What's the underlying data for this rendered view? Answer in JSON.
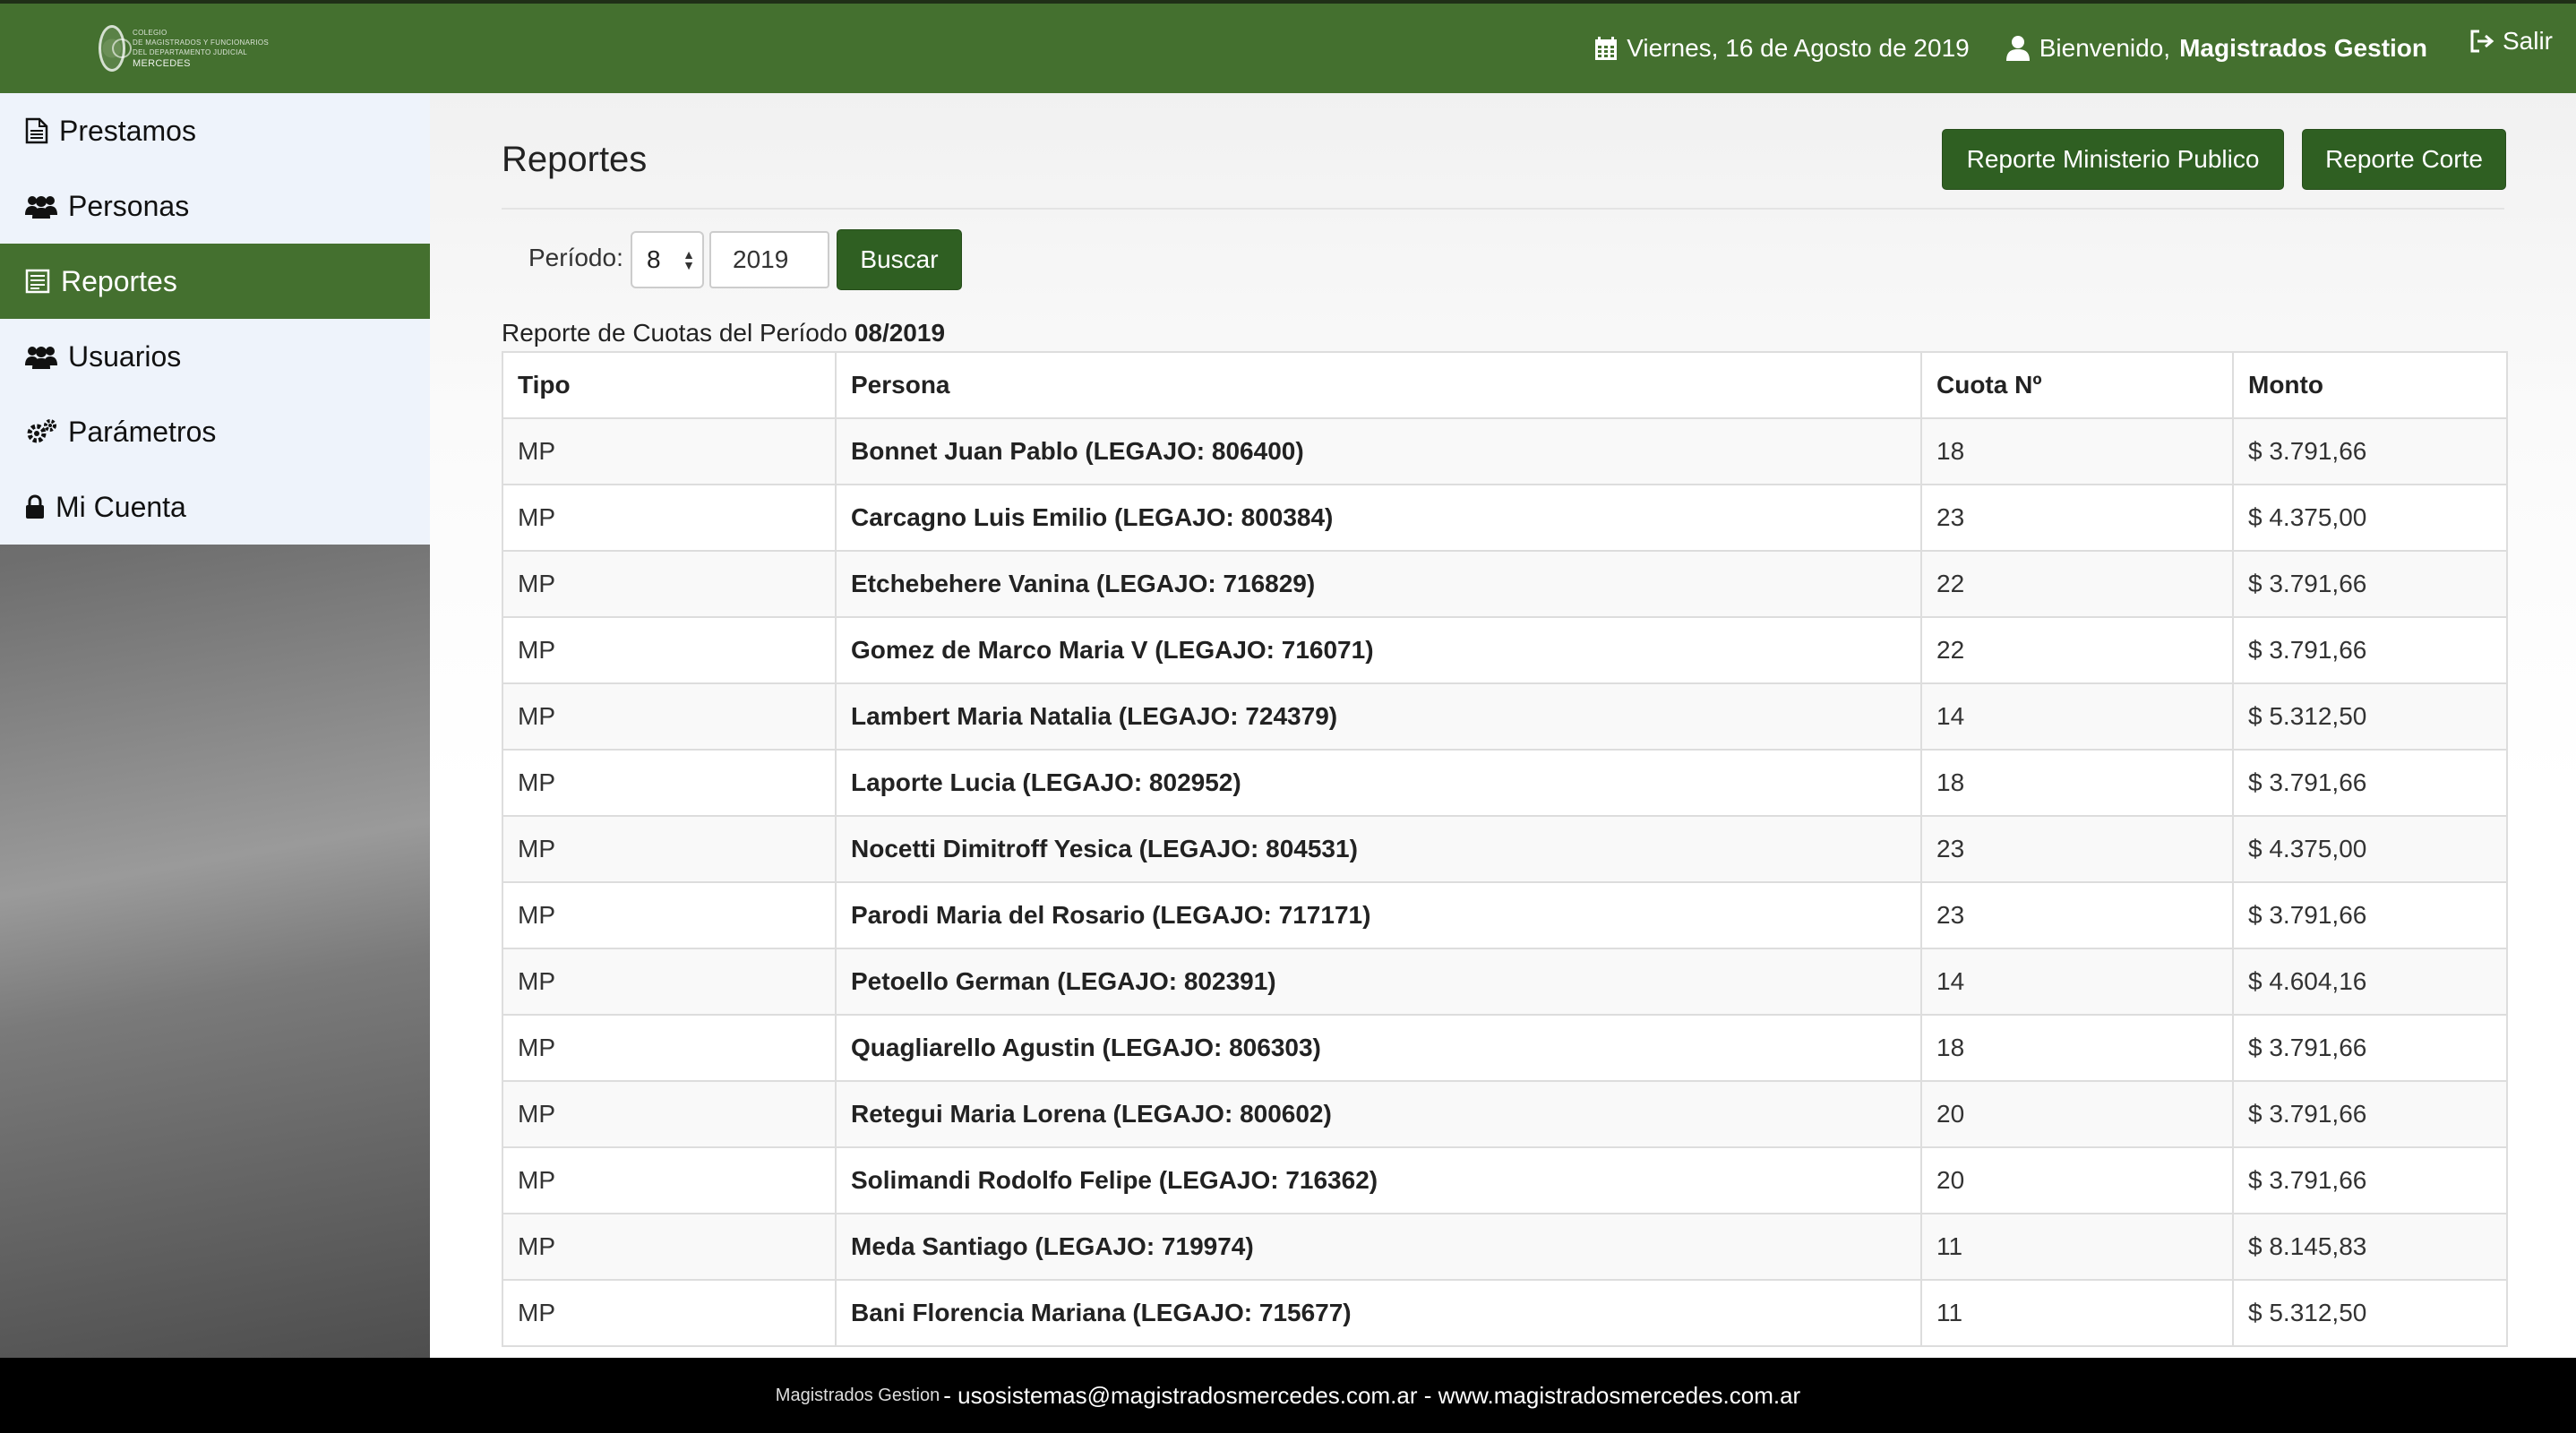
{
  "header": {
    "logo_lines": [
      "COLEGIO",
      "DE MAGISTRADOS Y FUNCIONARIOS",
      "DEL DEPARTAMENTO JUDICIAL",
      "MERCEDES"
    ],
    "date": "Viernes, 16 de Agosto de 2019",
    "welcome_prefix": "Bienvenido,",
    "user_name": "Magistrados Gestion",
    "logout_label": "Salir"
  },
  "sidebar": {
    "items": [
      {
        "label": "Prestamos",
        "icon": "document-icon"
      },
      {
        "label": "Personas",
        "icon": "users-icon"
      },
      {
        "label": "Reportes",
        "icon": "report-icon",
        "active": true
      },
      {
        "label": "Usuarios",
        "icon": "users-icon"
      },
      {
        "label": "Parámetros",
        "icon": "gears-icon"
      },
      {
        "label": "Mi Cuenta",
        "icon": "lock-icon"
      }
    ]
  },
  "main": {
    "title": "Reportes",
    "btn_ministerio": "Reporte Ministerio Publico",
    "btn_corte": "Reporte Corte",
    "filter": {
      "label": "Período:",
      "month": "8",
      "year": "2019",
      "search_label": "Buscar"
    },
    "caption_prefix": "Reporte de Cuotas del Período",
    "caption_period": "08/2019",
    "table": {
      "headers": [
        "Tipo",
        "Persona",
        "Cuota Nº",
        "Monto"
      ],
      "rows": [
        [
          "MP",
          "Bonnet Juan Pablo (LEGAJO: 806400)",
          "18",
          "$ 3.791,66"
        ],
        [
          "MP",
          "Carcagno Luis Emilio (LEGAJO: 800384)",
          "23",
          "$ 4.375,00"
        ],
        [
          "MP",
          "Etchebehere Vanina (LEGAJO: 716829)",
          "22",
          "$ 3.791,66"
        ],
        [
          "MP",
          "Gomez de Marco Maria V (LEGAJO: 716071)",
          "22",
          "$ 3.791,66"
        ],
        [
          "MP",
          "Lambert Maria Natalia (LEGAJO: 724379)",
          "14",
          "$ 5.312,50"
        ],
        [
          "MP",
          "Laporte Lucia (LEGAJO: 802952)",
          "18",
          "$ 3.791,66"
        ],
        [
          "MP",
          "Nocetti Dimitroff Yesica (LEGAJO: 804531)",
          "23",
          "$ 4.375,00"
        ],
        [
          "MP",
          "Parodi Maria del Rosario (LEGAJO: 717171)",
          "23",
          "$ 3.791,66"
        ],
        [
          "MP",
          "Petoello German (LEGAJO: 802391)",
          "14",
          "$ 4.604,16"
        ],
        [
          "MP",
          "Quagliarello Agustin (LEGAJO: 806303)",
          "18",
          "$ 3.791,66"
        ],
        [
          "MP",
          "Retegui Maria Lorena (LEGAJO: 800602)",
          "20",
          "$ 3.791,66"
        ],
        [
          "MP",
          "Solimandi Rodolfo Felipe (LEGAJO: 716362)",
          "20",
          "$ 3.791,66"
        ],
        [
          "MP",
          "Meda Santiago (LEGAJO: 719974)",
          "11",
          "$ 8.145,83"
        ],
        [
          "MP",
          "Bani Florencia Mariana (LEGAJO: 715677)",
          "11",
          "$ 5.312,50"
        ]
      ]
    }
  },
  "footer": {
    "app_name": "Magistrados Gestion",
    "separator": "-",
    "email": "usosistemas@magistradosmercedes.com.ar",
    "website": "www.magistradosmercedes.com.ar"
  },
  "colors": {
    "brand_green": "#44702f",
    "button_green": "#2f5f22",
    "footer_bg": "#000000"
  }
}
